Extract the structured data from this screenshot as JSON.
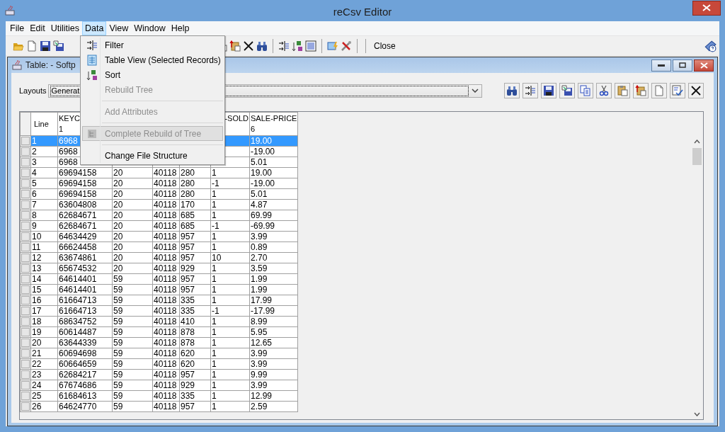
{
  "window": {
    "title": "reCsv Editor"
  },
  "menubar": [
    {
      "label": "File",
      "selected": false
    },
    {
      "label": "Edit",
      "selected": false
    },
    {
      "label": "Utilities",
      "selected": false
    },
    {
      "label": "Data",
      "selected": true
    },
    {
      "label": "View",
      "selected": false
    },
    {
      "label": "Window",
      "selected": false
    },
    {
      "label": "Help",
      "selected": false
    }
  ],
  "toolbar": {
    "close_label": "Close"
  },
  "data_menu": [
    {
      "kind": "item",
      "label": "Filter",
      "disabled": false,
      "highlighted": false
    },
    {
      "kind": "item",
      "label": "Table View (Selected Records)",
      "disabled": false,
      "highlighted": false
    },
    {
      "kind": "item",
      "label": "Sort",
      "disabled": false,
      "highlighted": false
    },
    {
      "kind": "item",
      "label": "Rebuild Tree",
      "disabled": true,
      "highlighted": false
    },
    {
      "kind": "separator"
    },
    {
      "kind": "item",
      "label": "Add Attributes",
      "disabled": true,
      "highlighted": false
    },
    {
      "kind": "separator"
    },
    {
      "kind": "item",
      "label": "Complete Rebuild of Tree",
      "disabled": true,
      "highlighted": true
    },
    {
      "kind": "separator"
    },
    {
      "kind": "item",
      "label": "Change File Structure",
      "disabled": false,
      "highlighted": false
    }
  ],
  "inner_window": {
    "title": "Table: - Softp"
  },
  "layouts": {
    "label": "Layouts",
    "value": "Generat"
  },
  "table": {
    "columns": [
      {
        "name": "Line"
      },
      {
        "name": "KEYC",
        "number": "1"
      },
      null,
      null,
      null,
      {
        "name": "-SOLD"
      },
      {
        "name": "SALE-PRICE",
        "number": "6"
      }
    ],
    "rows": [
      {
        "selected": true,
        "cells": [
          "1",
          "6968",
          null,
          null,
          null,
          null,
          "19.00"
        ]
      },
      {
        "selected": false,
        "cells": [
          "2",
          "6968",
          null,
          null,
          null,
          null,
          "-19.00"
        ]
      },
      {
        "selected": false,
        "cells": [
          "3",
          "6968",
          null,
          null,
          null,
          null,
          "5.01"
        ]
      },
      {
        "selected": false,
        "cells": [
          "4",
          "69694158",
          "20",
          "40118",
          "280",
          "1",
          "19.00"
        ]
      },
      {
        "selected": false,
        "cells": [
          "5",
          "69694158",
          "20",
          "40118",
          "280",
          "-1",
          "-19.00"
        ]
      },
      {
        "selected": false,
        "cells": [
          "6",
          "69694158",
          "20",
          "40118",
          "280",
          "1",
          "5.01"
        ]
      },
      {
        "selected": false,
        "cells": [
          "7",
          "63604808",
          "20",
          "40118",
          "170",
          "1",
          "4.87"
        ]
      },
      {
        "selected": false,
        "cells": [
          "8",
          "62684671",
          "20",
          "40118",
          "685",
          "1",
          "69.99"
        ]
      },
      {
        "selected": false,
        "cells": [
          "9",
          "62684671",
          "20",
          "40118",
          "685",
          "-1",
          "-69.99"
        ]
      },
      {
        "selected": false,
        "cells": [
          "10",
          "64634429",
          "20",
          "40118",
          "957",
          "1",
          "3.99"
        ]
      },
      {
        "selected": false,
        "cells": [
          "11",
          "66624458",
          "20",
          "40118",
          "957",
          "1",
          "0.89"
        ]
      },
      {
        "selected": false,
        "cells": [
          "12",
          "63674861",
          "20",
          "40118",
          "957",
          "10",
          "2.70"
        ]
      },
      {
        "selected": false,
        "cells": [
          "13",
          "65674532",
          "20",
          "40118",
          "929",
          "1",
          "3.59"
        ]
      },
      {
        "selected": false,
        "cells": [
          "14",
          "64614401",
          "59",
          "40118",
          "957",
          "1",
          "1.99"
        ]
      },
      {
        "selected": false,
        "cells": [
          "15",
          "64614401",
          "59",
          "40118",
          "957",
          "1",
          "1.99"
        ]
      },
      {
        "selected": false,
        "cells": [
          "16",
          "61664713",
          "59",
          "40118",
          "335",
          "1",
          "17.99"
        ]
      },
      {
        "selected": false,
        "cells": [
          "17",
          "61664713",
          "59",
          "40118",
          "335",
          "-1",
          "-17.99"
        ]
      },
      {
        "selected": false,
        "cells": [
          "18",
          "68634752",
          "59",
          "40118",
          "410",
          "1",
          "8.99"
        ]
      },
      {
        "selected": false,
        "cells": [
          "19",
          "60614487",
          "59",
          "40118",
          "878",
          "1",
          "5.95"
        ]
      },
      {
        "selected": false,
        "cells": [
          "20",
          "63644339",
          "59",
          "40118",
          "878",
          "1",
          "12.65"
        ]
      },
      {
        "selected": false,
        "cells": [
          "21",
          "60694698",
          "59",
          "40118",
          "620",
          "1",
          "3.99"
        ]
      },
      {
        "selected": false,
        "cells": [
          "22",
          "60664659",
          "59",
          "40118",
          "620",
          "1",
          "3.99"
        ]
      },
      {
        "selected": false,
        "cells": [
          "23",
          "62684217",
          "59",
          "40118",
          "957",
          "1",
          "9.99"
        ]
      },
      {
        "selected": false,
        "cells": [
          "24",
          "67674686",
          "59",
          "40118",
          "929",
          "1",
          "3.99"
        ]
      },
      {
        "selected": false,
        "cells": [
          "25",
          "61684613",
          "59",
          "40118",
          "335",
          "1",
          "12.99"
        ]
      },
      {
        "selected": false,
        "cells": [
          "26",
          "64624770",
          "59",
          "40118",
          "957",
          "1",
          "2.59"
        ]
      }
    ]
  }
}
